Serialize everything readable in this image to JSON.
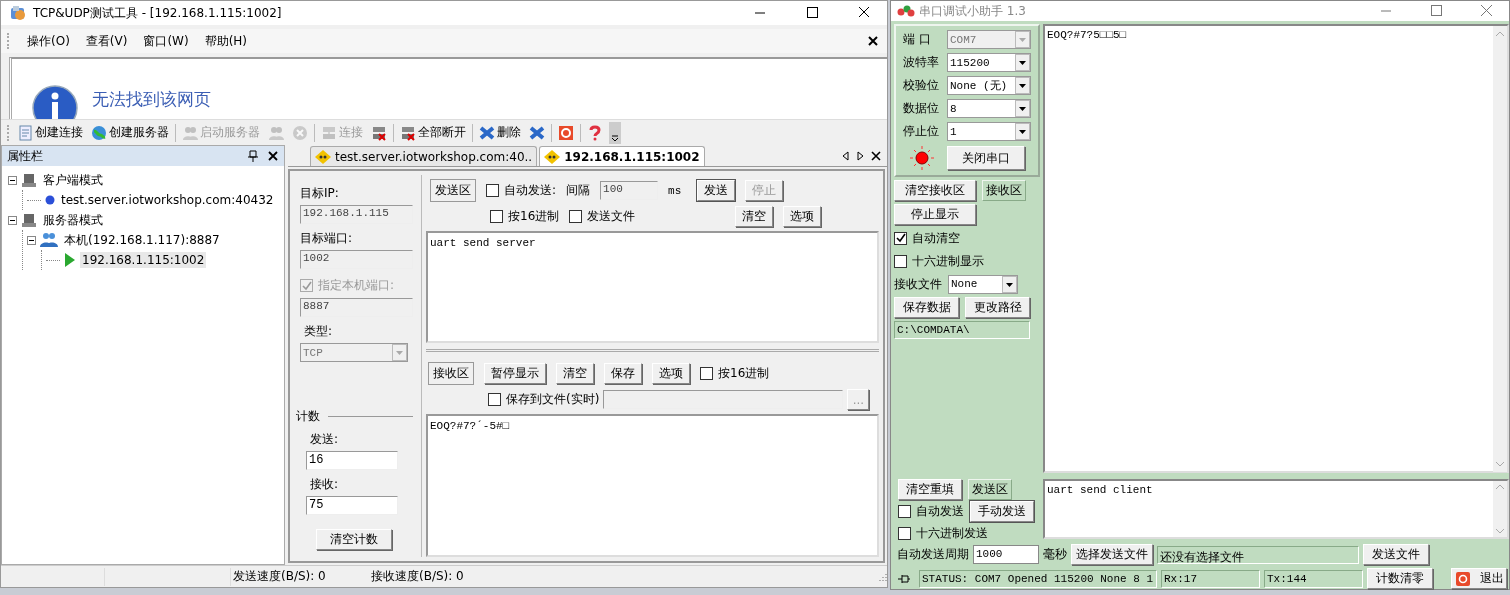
{
  "tcp_window": {
    "title": "TCP&UDP测试工具 - [192.168.1.115:1002]",
    "menu": [
      "操作(O)",
      "查看(V)",
      "窗口(W)",
      "帮助(H)"
    ],
    "browser_message": "无法找到该网页",
    "toolbar": [
      {
        "kind": "button",
        "label": "创建连接",
        "disabled": false
      },
      {
        "kind": "button",
        "label": "创建服务器",
        "disabled": false
      },
      {
        "kind": "separator"
      },
      {
        "kind": "button",
        "label": "启动服务器",
        "disabled": true
      },
      {
        "kind": "icon",
        "disabled": true
      },
      {
        "kind": "icon",
        "disabled": true
      },
      {
        "kind": "separator"
      },
      {
        "kind": "button",
        "label": "连接",
        "disabled": true
      },
      {
        "kind": "icon",
        "disabled": false
      },
      {
        "kind": "separator"
      },
      {
        "kind": "button",
        "label": "全部断开",
        "disabled": false
      },
      {
        "kind": "separator"
      },
      {
        "kind": "button",
        "label": "删除",
        "disabled": false
      },
      {
        "kind": "icon",
        "disabled": false
      },
      {
        "kind": "separator"
      },
      {
        "kind": "icon",
        "disabled": false
      },
      {
        "kind": "separator"
      },
      {
        "kind": "icon",
        "disabled": false
      }
    ],
    "sidebar": {
      "title": "属性栏",
      "tree": [
        {
          "kind": "mode",
          "label": "客户端模式",
          "expanded": true,
          "selected": false,
          "children": [
            {
              "kind": "client",
              "label": "test.server.iotworkshop.com:40432",
              "selected": false
            }
          ]
        },
        {
          "kind": "mode",
          "label": "服务器模式",
          "expanded": true,
          "selected": false,
          "children": [
            {
              "kind": "server",
              "label": "本机(192.168.1.117):8887",
              "expanded": true,
              "selected": false,
              "children": [
                {
                  "kind": "connection",
                  "label": "192.168.1.115:1002",
                  "selected": true
                }
              ]
            }
          ]
        }
      ]
    },
    "tabs": [
      {
        "label": "test.server.iotworkshop.com:40..",
        "selected": false
      },
      {
        "label": "192.168.1.115:1002",
        "selected": true
      }
    ],
    "settings": {
      "target_ip_label": "目标IP:",
      "target_ip": {
        "value": "192.168.1.115",
        "disabled": true
      },
      "target_port_label": "目标端口:",
      "target_port": {
        "value": "1002",
        "disabled": true
      },
      "local_port": {
        "label": "指定本机端口:",
        "checked": true,
        "disabled": true
      },
      "local_port_value": {
        "value": "8887",
        "disabled": true
      },
      "type_label": "类型:",
      "type": {
        "value": "TCP",
        "disabled": true
      },
      "count_title": "计数",
      "sent_label": "发送:",
      "sent": {
        "value": "16",
        "disabled": false
      },
      "received_label": "接收:",
      "received": {
        "value": "75",
        "disabled": false
      },
      "clear_count": "清空计数"
    },
    "send_area": {
      "title": "发送区",
      "auto_send": {
        "label": "自动发送:",
        "checked": false
      },
      "interval_label": "间隔",
      "interval": {
        "value": "100",
        "disabled": true
      },
      "unit": "ms",
      "send_button": {
        "label": "发送",
        "disabled": false
      },
      "stop_button": {
        "label": "停止",
        "disabled": true
      },
      "hex": {
        "label": "按16进制",
        "checked": false
      },
      "send_file": {
        "label": "发送文件",
        "checked": false
      },
      "clear_button": "清空",
      "options_button": "选项",
      "text": "uart send server"
    },
    "receive_area": {
      "title": "接收区",
      "buttons": [
        "暂停显示",
        "清空",
        "保存",
        "选项"
      ],
      "hex": {
        "label": "按16进制",
        "checked": false
      },
      "save_to_file": {
        "label": "保存到文件(实时)",
        "checked": false
      },
      "browse_button": "...",
      "text": "EOQ?#7?´-5#□"
    },
    "status_bar": [
      "发送速度(B/S): 0",
      "接收速度(B/S): 0"
    ]
  },
  "serial_window": {
    "title": "串口调试小助手 1.3",
    "port_settings": [
      {
        "label": "端 口",
        "value": "COM7",
        "disabled": true
      },
      {
        "label": "波特率",
        "value": "115200",
        "disabled": false
      },
      {
        "label": "校验位",
        "value": "None (无)",
        "disabled": false
      },
      {
        "label": "数据位",
        "value": "8",
        "disabled": false
      },
      {
        "label": "停止位",
        "value": "1",
        "disabled": false
      }
    ],
    "port_open": true,
    "close_port_button": "关闭串口",
    "clear_receive_button": "清空接收区",
    "receive_area_label": "接收区",
    "stop_display_button": "停止显示",
    "auto_clear": {
      "label": "自动清空",
      "checked": true
    },
    "hex_display": {
      "label": "十六进制显示",
      "checked": false
    },
    "receive_file_label": "接收文件",
    "receive_file": "None",
    "save_data_button": "保存数据",
    "change_path_button": "更改路径",
    "path": "C:\\COMDATA\\",
    "received_text": "EOQ?#7?5□□5□",
    "clear_send_button": "清空重填",
    "send_area_label": "发送区",
    "auto_send": {
      "label": "自动发送",
      "checked": false
    },
    "manual_send_button": "手动发送",
    "hex_send": {
      "label": "十六进制发送",
      "checked": false
    },
    "send_text": "uart send client",
    "period_label": "自动发送周期",
    "period": "1000",
    "period_unit": "毫秒",
    "choose_file_button": "选择发送文件",
    "file_status": "还没有选择文件",
    "send_file_button": "发送文件",
    "status": "STATUS: COM7 Opened 115200 None  8 1",
    "rx": "Rx:17",
    "tx": "Tx:144",
    "reset_count_button": "计数清零",
    "exit_button": "退出"
  }
}
